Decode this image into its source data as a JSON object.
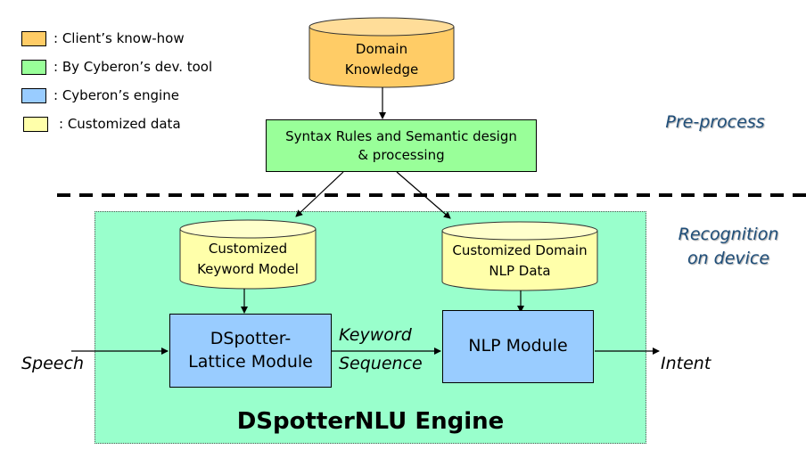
{
  "legend": [
    {
      "label": ": Client’s know-how",
      "color": "#ffcc66"
    },
    {
      "label": ": By Cyberon’s dev. tool",
      "color": "#99ff99"
    },
    {
      "label": ": Cyberon’s engine",
      "color": "#99ccff"
    },
    {
      "label": ": Customized data",
      "color": "#ffffaa"
    }
  ],
  "nodes": {
    "domain_knowledge": {
      "line1": "Domain",
      "line2": "Knowledge"
    },
    "syntax_rules": {
      "line1": "Syntax Rules and Semantic design",
      "line2": "& processing"
    },
    "keyword_model": {
      "line1": "Customized",
      "line2": "Keyword Model"
    },
    "nlp_data": {
      "line1": "Customized Domain",
      "line2": "NLP Data"
    },
    "dspotter": {
      "line1": "DSpotter-",
      "line2": "Lattice Module"
    },
    "nlp_module": {
      "label": "NLP Module"
    }
  },
  "flow_labels": {
    "speech": "Speech",
    "keyword_sequence_line1": "Keyword",
    "keyword_sequence_line2": "Sequence",
    "intent": "Intent"
  },
  "sections": {
    "preprocess": "Pre-process",
    "recognition_line1": "Recognition",
    "recognition_line2": "on device"
  },
  "engine_title": "DSpotterNLU Engine",
  "colors": {
    "client": "#ffcc66",
    "devtool": "#99ff99",
    "engine": "#99ccff",
    "custom": "#ffffaa",
    "engine_bg": "#99ffcc",
    "section_label": "#1f4e79"
  }
}
